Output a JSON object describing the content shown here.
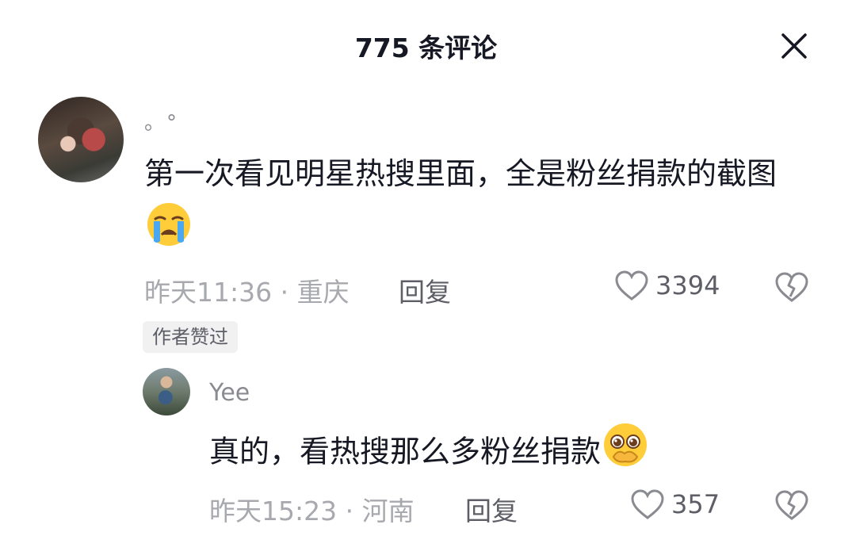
{
  "header": {
    "title": "775 条评论"
  },
  "comments": [
    {
      "username": "。°",
      "text": "第一次看见明星热搜里面，全是粉丝捐款的截图",
      "emoji_icon": "loudly-crying-face",
      "meta": "昨天11:36 · 重庆",
      "reply_label": "回复",
      "likes": "3394",
      "badge": "作者赞过"
    },
    {
      "username": "Yee",
      "text": "真的，看热搜那么多粉丝捐款",
      "emoji_icon": "pleading-face-holding-back-tears",
      "meta": "昨天15:23 · 河南",
      "reply_label": "回复",
      "likes": "357"
    }
  ],
  "colors": {
    "primary_text": "#161823",
    "secondary_text": "#a8a9ae",
    "badge_bg": "#f1f1f2"
  }
}
